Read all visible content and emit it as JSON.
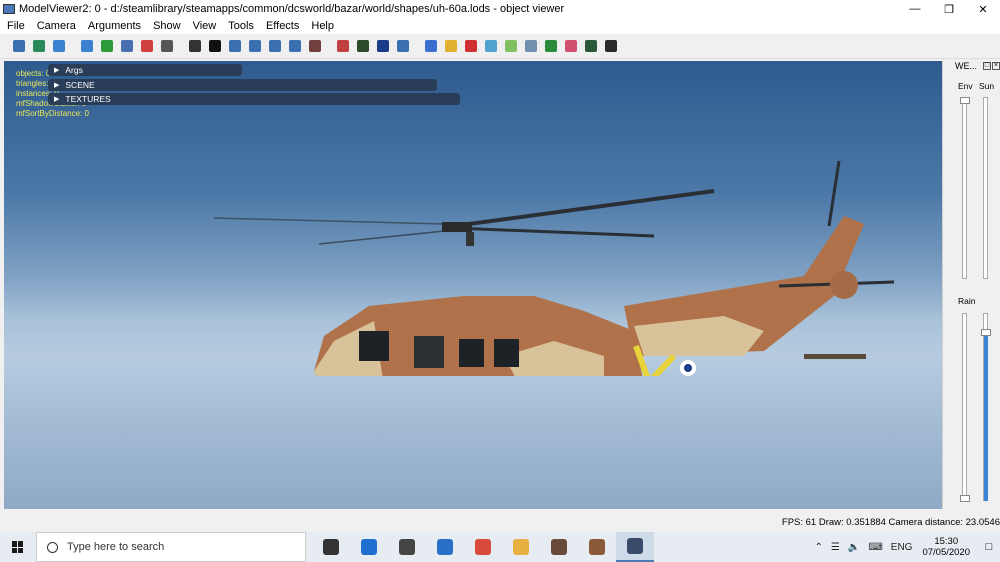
{
  "window": {
    "title": "ModelViewer2: 0 - d:/steamlibrary/steamapps/common/dcsworld/bazar/world/shapes/uh-60a.lods - object viewer",
    "controls": [
      "—",
      "❐",
      "✕"
    ]
  },
  "menu": [
    "File",
    "Camera",
    "Arguments",
    "Show",
    "View",
    "Tools",
    "Effects",
    "Help"
  ],
  "toolbar": {
    "icons": [
      {
        "name": "open-file-icon",
        "color": "#3a6fb0"
      },
      {
        "name": "figure-icon",
        "color": "#2a8a5a"
      },
      {
        "name": "sphere-icon",
        "color": "#3a82d0"
      },
      {
        "name": "refresh-icon",
        "color": "#3a82d0"
      },
      {
        "name": "reload-green-icon",
        "color": "#2d9a3a"
      },
      {
        "name": "grid-icon",
        "color": "#4a6fb0"
      },
      {
        "name": "runner-icon",
        "color": "#d04040"
      },
      {
        "name": "camera-icon",
        "color": "#555555"
      },
      {
        "name": "crosshair-icon",
        "color": "#333333"
      },
      {
        "name": "black-square-icon",
        "color": "#111111"
      },
      {
        "name": "filter-icon",
        "color": "#3a6fb0"
      },
      {
        "name": "person-icon",
        "color": "#3a6fb0"
      },
      {
        "name": "arrow-right-icon",
        "color": "#3a6fb0"
      },
      {
        "name": "speaker-icon",
        "color": "#3a6fb0"
      },
      {
        "name": "portrait-icon",
        "color": "#704040"
      },
      {
        "name": "palette-icon",
        "color": "#c04040"
      },
      {
        "name": "monitor-icon",
        "color": "#2a4a2a"
      },
      {
        "name": "undo-icon",
        "color": "#1a3a8a"
      },
      {
        "name": "bar-chart-icon",
        "color": "#3a6fb0"
      },
      {
        "name": "cube-blue-icon",
        "color": "#3a6fd0"
      },
      {
        "name": "cube-yellow-icon",
        "color": "#e0b030"
      },
      {
        "name": "cube-red-icon",
        "color": "#d03030"
      },
      {
        "name": "cube-cyan-icon",
        "color": "#50a0d0"
      },
      {
        "name": "cube-green-icon",
        "color": "#80c060"
      },
      {
        "name": "grid-outline-icon",
        "color": "#7090b0"
      },
      {
        "name": "grid-dots-icon",
        "color": "#2a8a3a"
      },
      {
        "name": "target-icon",
        "color": "#d05070"
      },
      {
        "name": "lamp-icon",
        "color": "#2a5a3a"
      },
      {
        "name": "gear-figure-icon",
        "color": "#2a2a2a"
      }
    ]
  },
  "viewport": {
    "stats": [
      "objects: 0",
      "triangles: 0",
      "instances: 0",
      "mfShadowCaster: 0",
      "mfSortByDistance: 0"
    ],
    "panels": [
      "Args",
      "SCENE",
      "TEXTURES"
    ]
  },
  "side_panel": {
    "title": "WE...",
    "env_label": "Env",
    "sun_label": "Sun",
    "rain_label": "Rain",
    "rain_level": 0.9
  },
  "status": {
    "text": "FPS: 61  Draw: 0.351884  Camera distance: 23.0546"
  },
  "taskbar": {
    "search_placeholder": "Type here to search",
    "apps": [
      "task-view-icon",
      "edge-icon",
      "store-icon",
      "mail-icon",
      "chrome-icon",
      "file-explorer-icon",
      "game-icon-1",
      "game-icon-2",
      "modelviewer-icon"
    ],
    "lang": "ENG",
    "time": "15:30",
    "date": "07/05/2020"
  },
  "colors": {
    "accent": "#4a7bb3",
    "stats_text": "#e8e85a",
    "panel_bg": "#2a3d58"
  }
}
